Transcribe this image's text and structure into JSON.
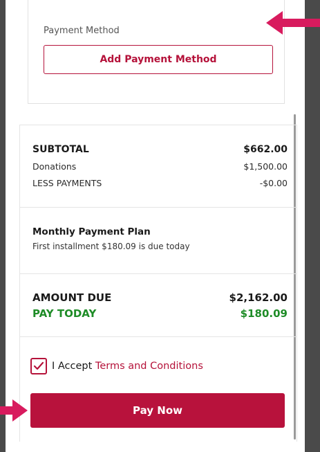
{
  "payment": {
    "method_label": "Payment Method",
    "add_button": "Add Payment Method"
  },
  "summary": {
    "subtotal_label": "SUBTOTAL",
    "subtotal_value": "$662.00",
    "donations_label": "Donations",
    "donations_value": "$1,500.00",
    "less_payments_label": "LESS PAYMENTS",
    "less_payments_value": "-$0.00",
    "plan_title": "Monthly Payment Plan",
    "plan_subtitle": "First installment $180.09 is due today",
    "amount_due_label": "AMOUNT DUE",
    "amount_due_value": "$2,162.00",
    "pay_today_label": "PAY TODAY",
    "pay_today_value": "$180.09"
  },
  "terms": {
    "checked": true,
    "prefix": "I Accept",
    "link": "Terms and Conditions"
  },
  "pay_button": "Pay Now",
  "colors": {
    "brand": "#b5123a",
    "green": "#1e8c27",
    "annotation_arrow": "#d81b5e"
  },
  "annotations": [
    "arrow-left-icon",
    "arrow-right-icon"
  ]
}
